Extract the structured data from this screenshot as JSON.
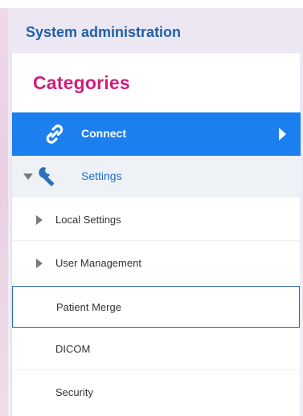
{
  "app": {
    "title": "System administration"
  },
  "panel": {
    "heading": "Categories"
  },
  "nav": {
    "connect": {
      "label": "Connect",
      "icon": "link-icon"
    },
    "settings": {
      "label": "Settings",
      "icon": "wrench-icon",
      "expanded": true,
      "items": [
        {
          "label": "Local Settings",
          "expandable": true
        },
        {
          "label": "User Management",
          "expandable": true
        },
        {
          "label": "Patient Merge",
          "expandable": false,
          "focused": true
        },
        {
          "label": "DICOM",
          "expandable": false
        },
        {
          "label": "Security",
          "expandable": false
        }
      ]
    }
  },
  "colors": {
    "accent": "#1b7ff0",
    "heading": "#d01e7d",
    "title": "#1f5fa9"
  }
}
